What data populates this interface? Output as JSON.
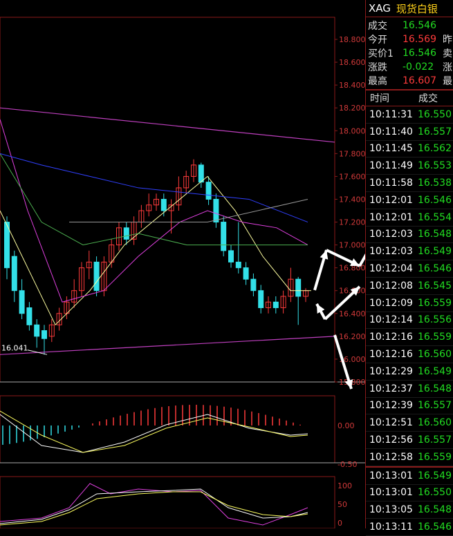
{
  "instrument": {
    "symbol": "XAG",
    "name": "现货白银"
  },
  "quotes": [
    {
      "label": "成交",
      "value": "16.546",
      "color": "#22dd22",
      "extra": ""
    },
    {
      "label": "今开",
      "value": "16.569",
      "color": "#ff3b3b",
      "extra": "昨"
    },
    {
      "label": "买价1",
      "value": "16.546",
      "color": "#22dd22",
      "extra": "卖"
    },
    {
      "label": "涨跌",
      "value": "-0.022",
      "color": "#22dd22",
      "extra": "涨"
    },
    {
      "label": "最高",
      "value": "16.607",
      "color": "#ff3b3b",
      "extra": "最"
    }
  ],
  "trades_header": {
    "time": "时间",
    "price": "成交"
  },
  "trades": [
    {
      "time": "10:11:31",
      "price": "16.550"
    },
    {
      "time": "10:11:40",
      "price": "16.557"
    },
    {
      "time": "10:11:45",
      "price": "16.562"
    },
    {
      "time": "10:11:49",
      "price": "16.553"
    },
    {
      "time": "10:11:58",
      "price": "16.538"
    },
    {
      "time": "10:12:01",
      "price": "16.546"
    },
    {
      "time": "10:12:01",
      "price": "16.554"
    },
    {
      "time": "10:12:03",
      "price": "16.548"
    },
    {
      "time": "10:12:03",
      "price": "16.549"
    },
    {
      "time": "10:12:04",
      "price": "16.546"
    },
    {
      "time": "10:12:08",
      "price": "16.545"
    },
    {
      "time": "10:12:09",
      "price": "16.559"
    },
    {
      "time": "10:12:14",
      "price": "16.556"
    },
    {
      "time": "10:12:16",
      "price": "16.559"
    },
    {
      "time": "10:12:16",
      "price": "16.560"
    },
    {
      "time": "10:12:29",
      "price": "16.549"
    },
    {
      "time": "10:12:37",
      "price": "16.548"
    },
    {
      "time": "10:12:39",
      "price": "16.557"
    },
    {
      "time": "10:12:51",
      "price": "16.560"
    },
    {
      "time": "10:12:56",
      "price": "16.557"
    },
    {
      "time": "10:12:58",
      "price": "16.559"
    },
    {
      "time": "10:13:01",
      "price": "16.549"
    },
    {
      "time": "10:13:01",
      "price": "16.550"
    },
    {
      "time": "10:13:05",
      "price": "16.548"
    },
    {
      "time": "10:13:11",
      "price": "16.546"
    }
  ],
  "price_axis": {
    "labels": [
      "18.800",
      "18.600",
      "18.400",
      "18.200",
      "18.000",
      "17.800",
      "17.600",
      "17.400",
      "17.200",
      "17.000",
      "16.800",
      "16.600",
      "16.400",
      "16.200",
      "16.000",
      "15.800"
    ],
    "min": 15.8,
    "max": 18.8
  },
  "low_marker": "16.041",
  "macd_axis": {
    "labels": [
      "0.00",
      "-0.50"
    ]
  },
  "kdj_axis": {
    "labels": [
      "100",
      "50",
      "0"
    ]
  },
  "colors": {
    "up": "#ff3b3b",
    "down": "#33e0e8",
    "grid": "#8b1a1a",
    "ma5": "#ffffa0",
    "ma10": "#e040e0",
    "ma20": "#4caf50",
    "ma60": "#3040ff"
  }
}
